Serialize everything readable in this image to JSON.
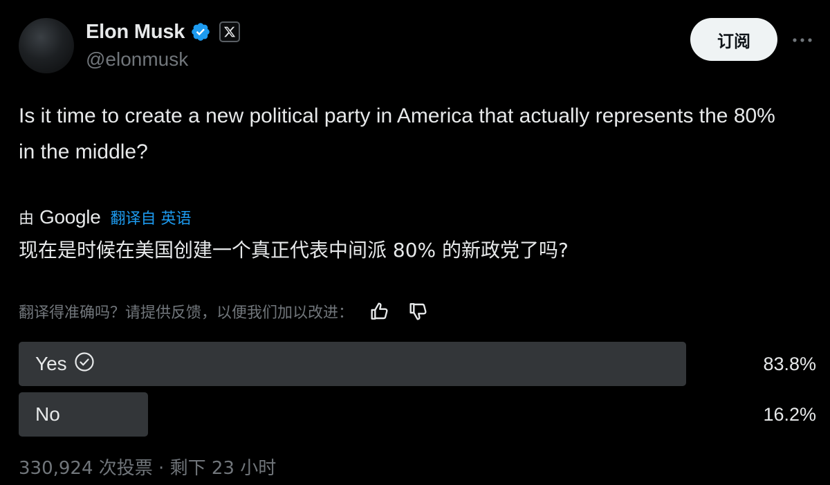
{
  "author": {
    "display_name": "Elon Musk",
    "handle": "@elonmusk",
    "verified_badge": "verified-check-icon",
    "affiliation_badge": "x-logo-icon",
    "badge_color": "#1d9bf0"
  },
  "header": {
    "subscribe_label": "订阅",
    "more_icon": "more-dots-icon"
  },
  "tweet": {
    "text": "Is it time to create a new political party in America that actually represents the 80% in the middle?"
  },
  "translation": {
    "by_label": "由",
    "provider": "Google",
    "translated_from": "翻译自 英语",
    "text": "现在是时候在美国创建一个真正代表中间派 80% 的新政党了吗?",
    "feedback_prompt": "翻译得准确吗？请提供反馈，以便我们加以改进：",
    "thumbs_up_icon": "thumbs-up-icon",
    "thumbs_down_icon": "thumbs-down-icon"
  },
  "poll": {
    "options": [
      {
        "label": "Yes",
        "percent": 83.8,
        "percent_label": "83.8%",
        "selected": true
      },
      {
        "label": "No",
        "percent": 16.2,
        "percent_label": "16.2%",
        "selected": false
      }
    ],
    "footer": "330,924 次投票 · 剩下 23 小时",
    "bar_color": "#333639"
  },
  "colors": {
    "background": "#000000",
    "text_primary": "#e7e9ea",
    "text_secondary": "#71767b",
    "link": "#1d9bf0"
  }
}
